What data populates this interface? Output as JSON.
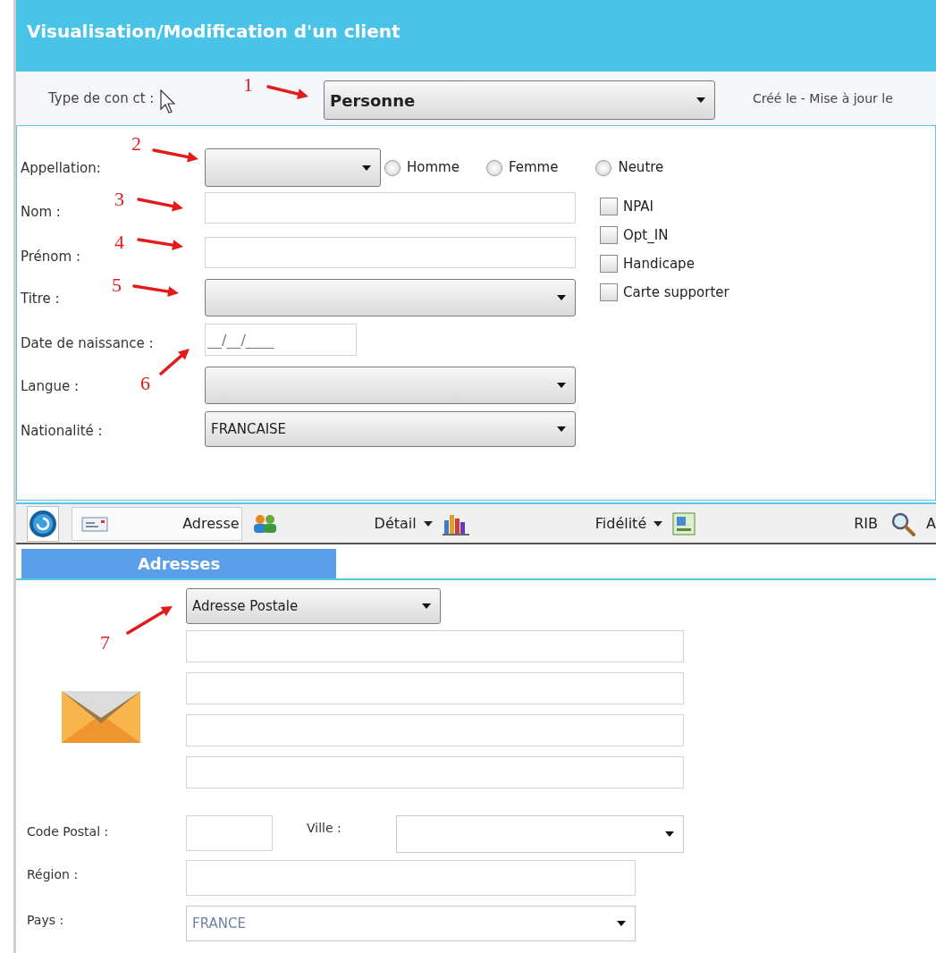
{
  "window": {
    "title": "Visualisation/Modification d'un client"
  },
  "contact_type": {
    "label": "Type de con ct :",
    "value": "Personne",
    "meta": "Créé le  - Mise à jour le"
  },
  "fields": [
    {
      "label": "Appellation:",
      "kind": "select"
    },
    {
      "label": "Nom :",
      "kind": "text"
    },
    {
      "label": "Prénom :",
      "kind": "text"
    },
    {
      "label": "Titre :",
      "kind": "select"
    },
    {
      "label": "Date de naissance :",
      "kind": "date",
      "placeholder": "__/__/____"
    },
    {
      "label": "Langue :",
      "kind": "select"
    },
    {
      "label": "Nationalité :",
      "kind": "select",
      "value": "FRANCAISE"
    }
  ],
  "radios": [
    {
      "label": "Homme",
      "selected": false
    },
    {
      "label": "Femme",
      "selected": false
    },
    {
      "label": "Neutre",
      "selected": false
    }
  ],
  "checkboxes": [
    {
      "label": "NPAI",
      "checked": false
    },
    {
      "label": "Opt_IN",
      "checked": false
    },
    {
      "label": "Handicape",
      "checked": false
    },
    {
      "label": "Carte supporter",
      "checked": false
    }
  ],
  "toolbar": [
    {
      "label": "Adresse",
      "selected": true,
      "dropdown": false
    },
    {
      "label": "Détail",
      "selected": false,
      "dropdown": true
    },
    {
      "label": "Fidélité",
      "selected": false,
      "dropdown": true
    },
    {
      "label": "RIB",
      "selected": false,
      "dropdown": false
    },
    {
      "label": "A",
      "selected": false,
      "dropdown": false
    }
  ],
  "tabs": [
    {
      "label": "Adresses",
      "selected": true
    }
  ],
  "address": {
    "type": "Adresse Postale",
    "fields": [
      {
        "label": "Code Postal :",
        "kind": "text"
      },
      {
        "label": "Ville :",
        "kind": "select"
      },
      {
        "label": "Région :",
        "kind": "text"
      },
      {
        "label": "Pays :",
        "kind": "select",
        "value": "FRANCE"
      }
    ]
  },
  "annotations": [
    {
      "label": "1"
    },
    {
      "label": "2"
    },
    {
      "label": "3"
    },
    {
      "label": "4"
    },
    {
      "label": "5"
    },
    {
      "label": "6"
    },
    {
      "label": "7"
    }
  ]
}
